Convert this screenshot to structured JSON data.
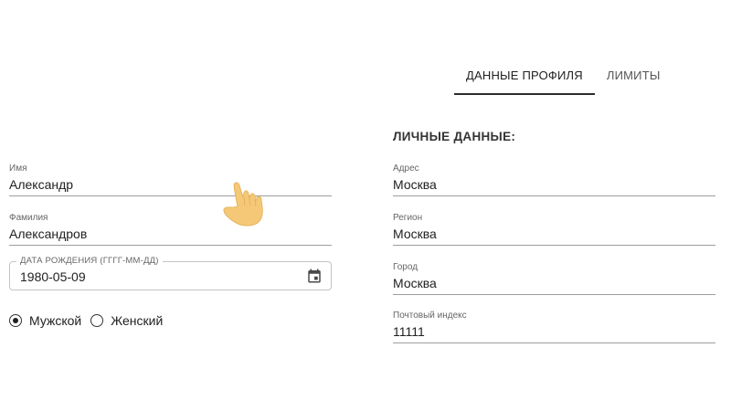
{
  "tabs": [
    {
      "label": "ДАННЫЕ ПРОФИЛЯ",
      "active": true
    },
    {
      "label": "ЛИМИТЫ",
      "active": false
    }
  ],
  "left_form": {
    "first_name": {
      "label": "Имя",
      "value": "Александр"
    },
    "last_name": {
      "label": "Фамилия",
      "value": "Александров"
    },
    "birth_date": {
      "label": "ДАТА РОЖДЕНИЯ (ГГГГ-ММ-ДД)",
      "value": "1980-05-09",
      "icon": "calendar-icon"
    },
    "gender": {
      "options": [
        {
          "label": "Мужской",
          "checked": true
        },
        {
          "label": "Женский",
          "checked": false
        }
      ]
    }
  },
  "right_form": {
    "section_title": "ЛИЧНЫЕ ДАННЫЕ:",
    "address": {
      "label": "Адрес",
      "value": "Москва"
    },
    "region": {
      "label": "Регион",
      "value": "Москва"
    },
    "city": {
      "label": "Город",
      "value": "Москва"
    },
    "postal_code": {
      "label": "Почтовый индекс",
      "value": "11111"
    }
  },
  "overlay": {
    "icon": "pointing-hand-icon",
    "color": "#F4C877"
  }
}
